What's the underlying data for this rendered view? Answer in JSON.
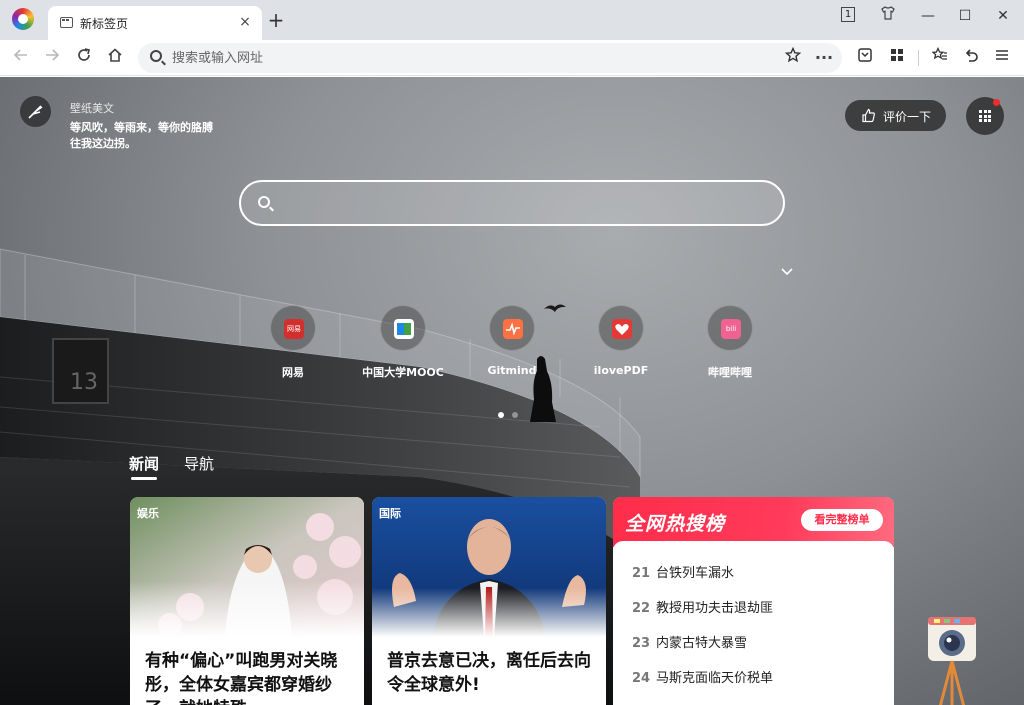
{
  "browser": {
    "tab": {
      "title": "新标签页",
      "close": "×"
    },
    "new_tab": "+",
    "window_badge": "1",
    "window_controls": {
      "minimize": "—",
      "maximize": "☐",
      "close": "✕"
    },
    "omnibox": {
      "placeholder": "搜索或输入网址",
      "value": ""
    },
    "more_label": "···"
  },
  "wallpaper": {
    "title": "壁纸美文",
    "description": "等风吹，等雨来，等你的胳膊往我这边拐。"
  },
  "rate_button": "评价一下",
  "search": {
    "placeholder": "",
    "value": ""
  },
  "sites": [
    {
      "label": "网易",
      "logo_text": "网易",
      "color": "#d32f2f"
    },
    {
      "label": "中国大学MOOC",
      "logo_text": "",
      "color": "#ffffff"
    },
    {
      "label": "Gitmind",
      "logo_text": "",
      "color": "#ff7043"
    },
    {
      "label": "ilovePDF",
      "logo_text": "",
      "color": "#e53935"
    },
    {
      "label": "哔哩哔哩",
      "logo_text": "bili",
      "color": "#f06292"
    }
  ],
  "news_tabs": [
    {
      "label": "新闻",
      "active": true
    },
    {
      "label": "导航",
      "active": false
    }
  ],
  "cards": [
    {
      "tag": "娱乐",
      "title": "有种“偏心”叫跑男对关晓彤，全体女嘉宾都穿婚纱了，就她特殊"
    },
    {
      "tag": "国际",
      "title": "普京去意已决，离任后去向令全球意外!"
    }
  ],
  "hot_list": {
    "title": "全网热搜榜",
    "more": "看完整榜单",
    "items": [
      {
        "rank": "21",
        "text": "台铁列车漏水"
      },
      {
        "rank": "22",
        "text": "教授用功夫击退劫匪"
      },
      {
        "rank": "23",
        "text": "内蒙古特大暴雪"
      },
      {
        "rank": "24",
        "text": "马斯克面临天价税单"
      }
    ]
  },
  "colors": {
    "accent_red": "#ff2d4a",
    "toolbar_bg": "#ffffff",
    "tabbar_bg": "#dee1e6"
  }
}
